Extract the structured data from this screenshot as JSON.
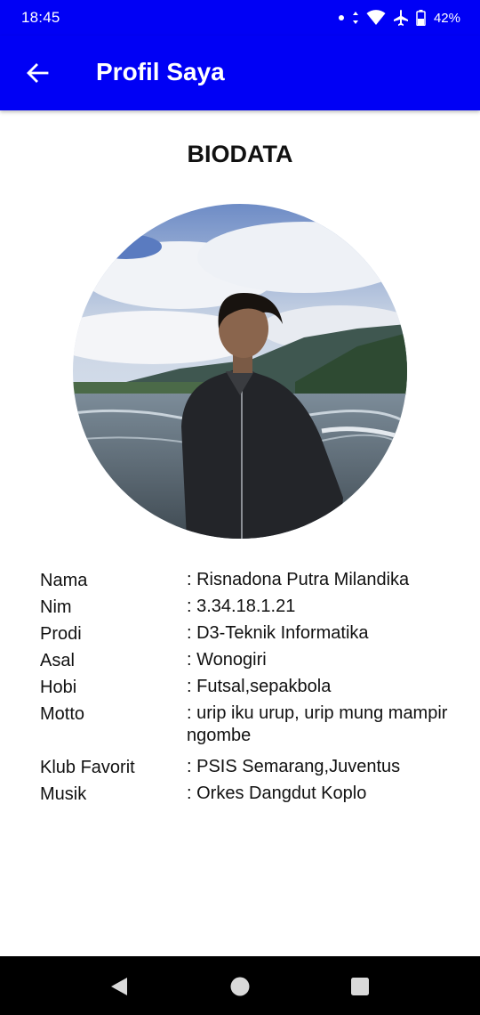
{
  "status_bar": {
    "time": "18:45",
    "battery_percent": "42%",
    "icons": [
      "notification-dot-icon",
      "data-arrows-icon",
      "wifi-icon",
      "airplane-icon",
      "battery-icon"
    ]
  },
  "app_bar": {
    "title": "Profil Saya",
    "back_icon": "arrow-back-icon",
    "background_color": "#0000f5"
  },
  "biodata": {
    "heading": "BIODATA",
    "rows": [
      {
        "label": "Nama",
        "value": ": Risnadona Putra Milandika"
      },
      {
        "label": "Nim",
        "value": ": 3.34.18.1.21"
      },
      {
        "label": "Prodi",
        "value": ": D3-Teknik Informatika"
      },
      {
        "label": "Asal",
        "value": ": Wonogiri"
      },
      {
        "label": "Hobi",
        "value": ": Futsal,sepakbola"
      },
      {
        "label": "Motto",
        "value": ": urip iku urup, urip mung mampir ngombe"
      },
      {
        "label": "Klub Favorit",
        "value": ": PSIS Semarang,Juventus"
      },
      {
        "label": "Musik",
        "value": ": Orkes Dangdut Koplo"
      }
    ]
  },
  "nav_bar": {
    "icons": [
      "back-triangle-icon",
      "home-circle-icon",
      "recents-square-icon"
    ]
  }
}
